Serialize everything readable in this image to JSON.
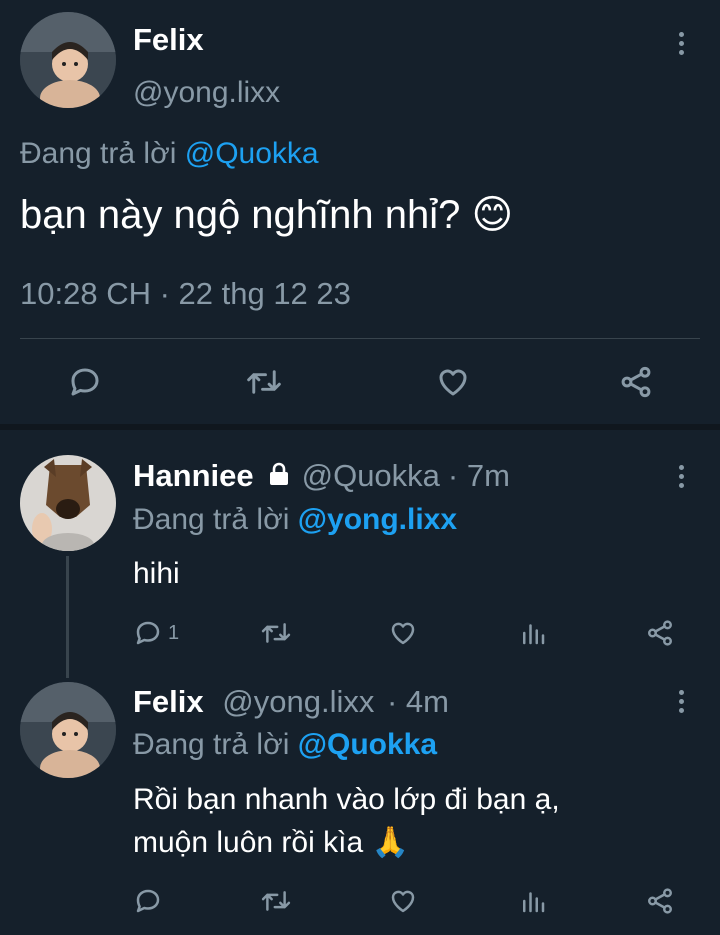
{
  "main_tweet": {
    "name": "Felix",
    "handle": "@yong.lixx",
    "replying_prefix": "Đang trả lời",
    "replying_to": "@Quokka",
    "text": "bạn này ngộ nghĩnh nhỉ?",
    "emoji": "😊",
    "timestamp": "10:28 CH · 22 thg 12 23"
  },
  "replies": [
    {
      "name": "Hanniee",
      "handle": "@Quokka",
      "time": "· 7m",
      "replying_prefix": "Đang trả lời",
      "replying_to": "@yong.lixx",
      "text": "hihi",
      "reply_count": "1"
    },
    {
      "name": "Felix",
      "handle": "@yong.lixx",
      "time": "· 4m",
      "replying_prefix": "Đang trả lời",
      "replying_to": "@Quokka",
      "text_line1": "Rồi bạn nhanh vào lớp đi bạn ạ,",
      "text_line2": "muộn luôn rồi kìa",
      "emoji": "🙏"
    }
  ],
  "colors": {
    "background": "#15202b",
    "muted": "#8899a6",
    "link": "#1da1f2",
    "divider": "#38444d"
  },
  "icons": [
    "reply-icon",
    "retweet-icon",
    "like-icon",
    "share-icon",
    "analytics-icon",
    "lock-icon",
    "more-icon"
  ]
}
